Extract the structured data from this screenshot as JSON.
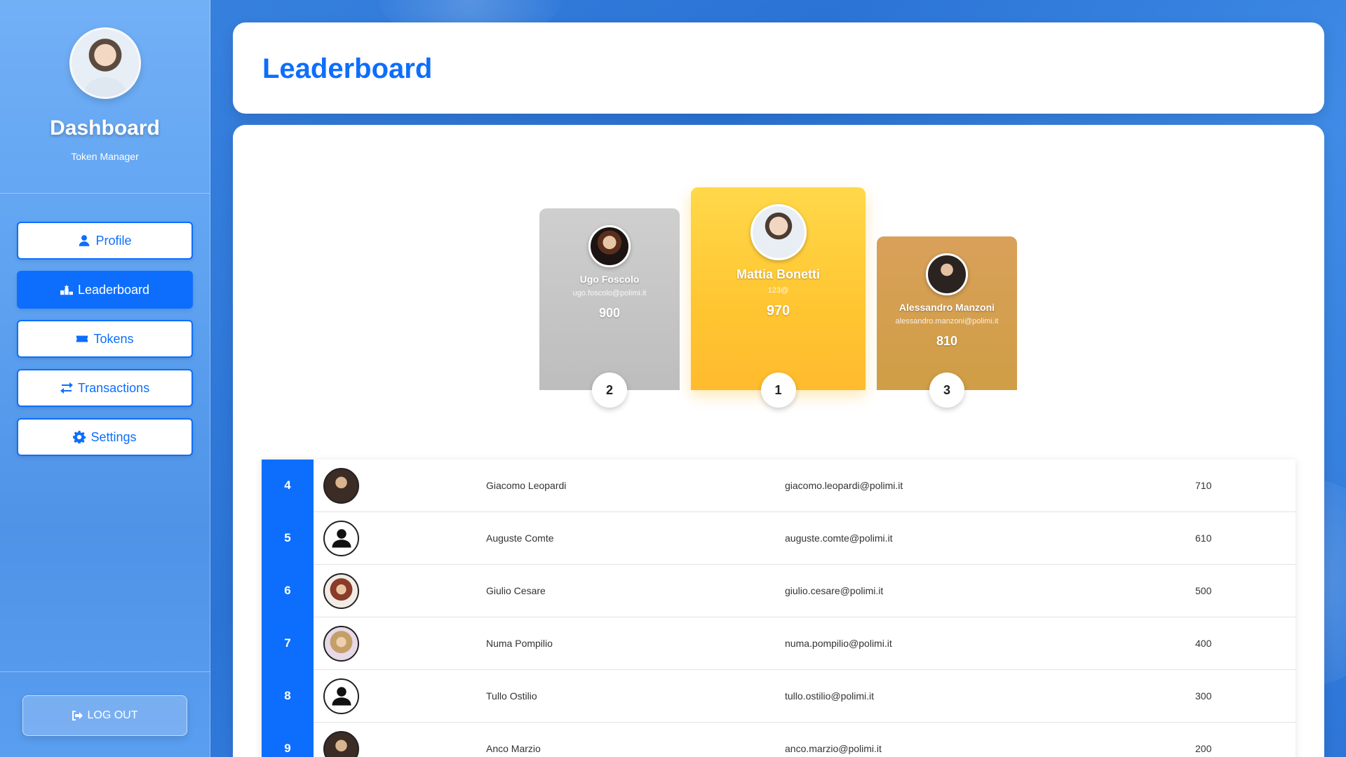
{
  "sidebar": {
    "title": "Dashboard",
    "subtitle": "Token Manager",
    "nav": [
      {
        "label": "Profile",
        "icon": "user-icon",
        "active": false
      },
      {
        "label": "Leaderboard",
        "icon": "ranking-icon",
        "active": true
      },
      {
        "label": "Tokens",
        "icon": "ticket-icon",
        "active": false
      },
      {
        "label": "Transactions",
        "icon": "exchange-icon",
        "active": false
      },
      {
        "label": "Settings",
        "icon": "gear-icon",
        "active": false
      }
    ],
    "logout_label": "LOG OUT"
  },
  "header": {
    "title": "Leaderboard"
  },
  "podium": {
    "first": {
      "rank": "1",
      "name": "Mattia Bonetti",
      "email": "123@",
      "score": "970"
    },
    "second": {
      "rank": "2",
      "name": "Ugo Foscolo",
      "email": "ugo.foscolo@polimi.it",
      "score": "900"
    },
    "third": {
      "rank": "3",
      "name": "Alessandro Manzoni",
      "email": "alessandro.manzoni@polimi.it",
      "score": "810"
    }
  },
  "table": {
    "rows": [
      {
        "rank": "4",
        "name": "Giacomo Leopardi",
        "email": "giacomo.leopardi@polimi.it",
        "score": "710",
        "avatar": "portrait"
      },
      {
        "rank": "5",
        "name": "Auguste Comte",
        "email": "auguste.comte@polimi.it",
        "score": "610",
        "avatar": "default-user-icon"
      },
      {
        "rank": "6",
        "name": "Giulio Cesare",
        "email": "giulio.cesare@polimi.it",
        "score": "500",
        "avatar": "portrait"
      },
      {
        "rank": "7",
        "name": "Numa Pompilio",
        "email": "numa.pompilio@polimi.it",
        "score": "400",
        "avatar": "portrait"
      },
      {
        "rank": "8",
        "name": "Tullo Ostilio",
        "email": "tullo.ostilio@polimi.it",
        "score": "300",
        "avatar": "default-user-icon"
      },
      {
        "rank": "9",
        "name": "Anco Marzio",
        "email": "anco.marzio@polimi.it",
        "score": "200",
        "avatar": "portrait"
      }
    ]
  },
  "colors": {
    "accent": "#0d6efd",
    "gold": "#ffc531",
    "silver": "#c4c4c4",
    "bronze": "#d4a050"
  }
}
